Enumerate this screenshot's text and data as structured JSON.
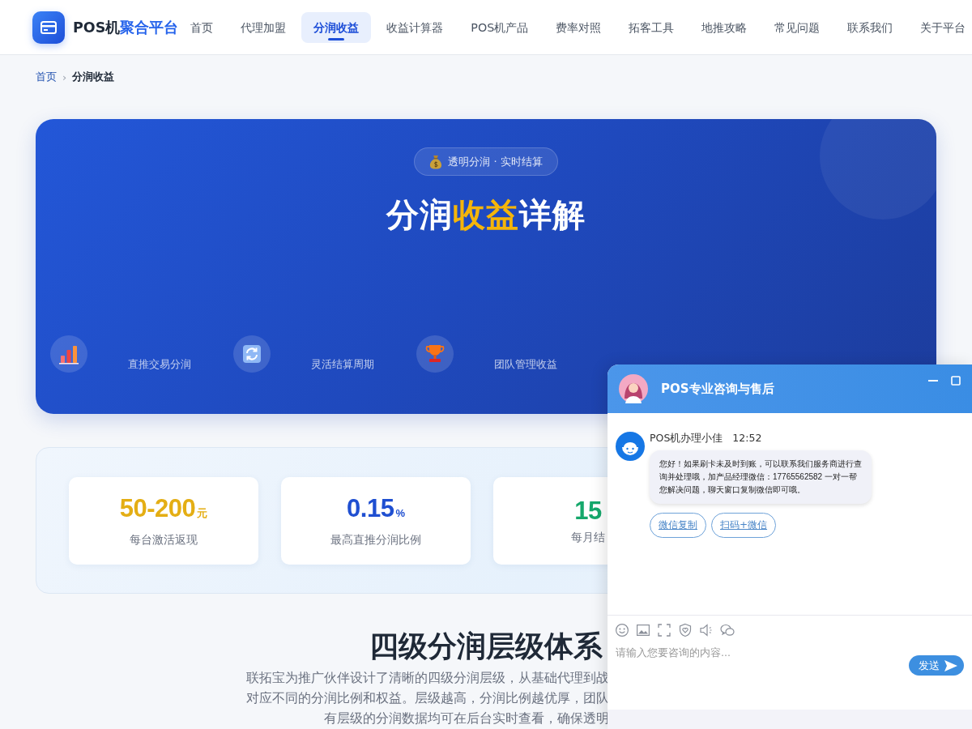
{
  "header": {
    "brand": {
      "dark": "POS机",
      "accent": "聚合平台"
    },
    "nav": [
      {
        "label": "首页",
        "selected": false
      },
      {
        "label": "代理加盟",
        "selected": false
      },
      {
        "label": "分润收益",
        "selected": true
      },
      {
        "label": "收益计算器",
        "selected": false
      },
      {
        "label": "POS机产品",
        "selected": false
      },
      {
        "label": "费率对照",
        "selected": false
      },
      {
        "label": "拓客工具",
        "selected": false
      },
      {
        "label": "地推攻略",
        "selected": false
      },
      {
        "label": "常见问题",
        "selected": false
      },
      {
        "label": "联系我们",
        "selected": false
      },
      {
        "label": "关于平台",
        "selected": false
      }
    ]
  },
  "breadcrumb": {
    "separator": "›",
    "items": [
      {
        "label": "首页",
        "current": false
      },
      {
        "label": "分润收益",
        "current": true
      }
    ]
  },
  "hero": {
    "badge": "透明分润 · 实时结算",
    "title": [
      {
        "text": "分润",
        "highlight": false
      },
      {
        "text": "收益",
        "highlight": true
      },
      {
        "text": "详解",
        "highlight": false
      }
    ],
    "features": [
      {
        "label": "直推交易分润"
      },
      {
        "label": "灵活结算周期"
      },
      {
        "label": "团队管理收益"
      }
    ]
  },
  "stats": [
    {
      "value": "50-200",
      "unit": "元",
      "label": "每台激活返现",
      "color": "#e4ae14"
    },
    {
      "value": "0.15",
      "unit": "%",
      "label": "最高直推分润比例",
      "color": "#1f4fd1"
    },
    {
      "value": "15",
      "label": "每月结",
      "color": "#16a86c"
    }
  ],
  "tiers": {
    "title": "四级分润层级体系",
    "lines": [
      "联拓宝为推广伙伴设计了清晰的四级分润层级，从基础代理到战",
      "对应不同的分润比例和权益。层级越高，分润比例越优厚，团队",
      "有层级的分润数据均可在后台实时查看，确保透明"
    ]
  },
  "chat": {
    "title": "POS专业咨询与售后",
    "messages": [
      {
        "sender": "POS机办理小佳",
        "time": "12:52",
        "text": "您好！如果刷卡未及时到账，可以联系我们服务商进行查询并处理哦，加产品经理微信：17765562582 一对一帮您解决问题，聊天窗口复制微信即可哦。",
        "actions": [
          "微信复制",
          "扫码+微信"
        ]
      }
    ],
    "input": {
      "placeholder": "请输入您要咨询的内容..."
    },
    "send": "发送"
  }
}
